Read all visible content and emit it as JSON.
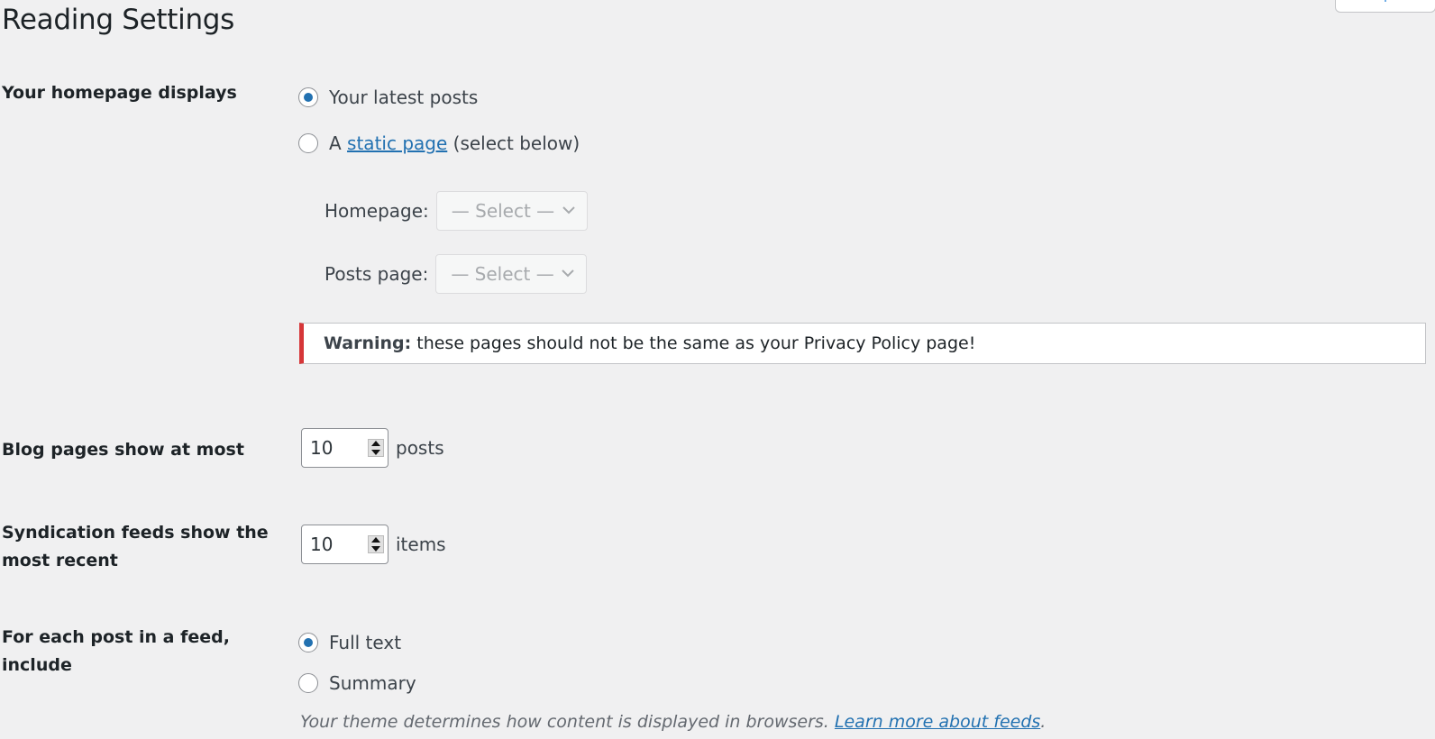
{
  "page": {
    "title": "Reading Settings"
  },
  "homepage": {
    "label": "Your homepage displays",
    "option_latest": "Your latest posts",
    "option_static_prefix": "A",
    "option_static_link": "static page",
    "option_static_suffix": "(select below)",
    "selected": "latest",
    "homepage_label": "Homepage:",
    "homepage_value": "— Select —",
    "posts_page_label": "Posts page:",
    "posts_page_value": "— Select —"
  },
  "warning": {
    "strong": "Warning:",
    "text": "these pages should not be the same as your Privacy Policy page!",
    "color": "#d63638"
  },
  "blog_pages": {
    "label": "Blog pages show at most",
    "value": "10",
    "unit": "posts"
  },
  "feeds": {
    "label": "Syndication feeds show the most recent",
    "value": "10",
    "unit": "items"
  },
  "feed_content": {
    "label": "For each post in a feed, include",
    "option_full": "Full text",
    "option_summary": "Summary",
    "selected": "full",
    "description": "Your theme determines how content is displayed in browsers.",
    "link": "Learn more about feeds",
    "link_suffix": "."
  },
  "colors": {
    "accent": "#2271b1",
    "background": "#f0f0f1"
  }
}
